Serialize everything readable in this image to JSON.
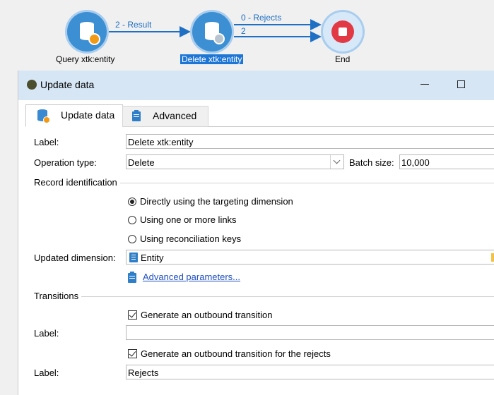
{
  "workflow": {
    "nodes": {
      "query": "Query xtk:entity",
      "delete": "Delete xtk:entity",
      "end": "End"
    },
    "transitions": {
      "result": "2 - Result",
      "rejects": "0 - Rejects",
      "count": "2"
    }
  },
  "dialog": {
    "title": "Update data",
    "tabs": [
      "Update data",
      "Advanced"
    ],
    "label_caption": "Label:",
    "label_value": "Delete xtk:entity",
    "operation_caption": "Operation type:",
    "operation_value": "Delete",
    "batch_caption": "Batch size:",
    "batch_value": "10,000",
    "record_identification": {
      "title": "Record identification",
      "options": [
        "Directly using the targeting dimension",
        "Using one or more links",
        "Using reconciliation keys"
      ],
      "selected": 0
    },
    "updated_dimension_caption": "Updated dimension:",
    "updated_dimension_value": "Entity",
    "advanced_link": "Advanced parameters...",
    "transitions": {
      "title": "Transitions",
      "outbound_label": "Generate an outbound transition",
      "outbound_checked": true,
      "label1_caption": "Label:",
      "label1_value": "",
      "rejects_label": "Generate an outbound transition for the rejects",
      "rejects_checked": true,
      "label2_caption": "Label:",
      "label2_value": "Rejects"
    }
  }
}
